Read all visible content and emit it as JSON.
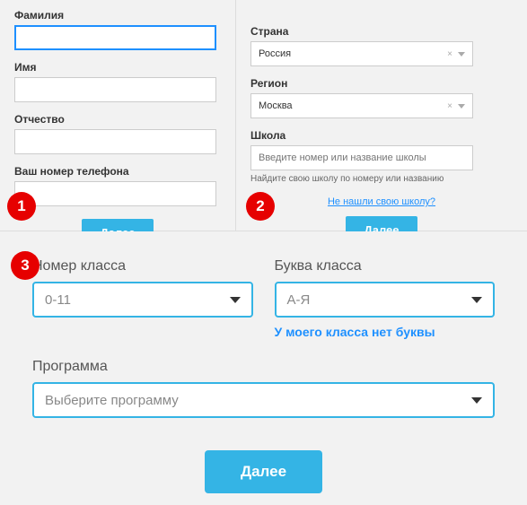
{
  "panel1": {
    "last_name_label": "Фамилия",
    "first_name_label": "Имя",
    "patronymic_label": "Отчество",
    "phone_label": "Ваш номер телефона",
    "next": "Далее"
  },
  "panel2": {
    "country_label": "Страна",
    "country_value": "Россия",
    "region_label": "Регион",
    "region_value": "Москва",
    "school_label": "Школа",
    "school_placeholder": "Введите номер или название школы",
    "school_hint": "Найдите свою школу по номеру или названию",
    "not_found_link": "Не нашли свою школу?",
    "next": "Далее"
  },
  "panel3": {
    "class_num_label": "Номер класса",
    "class_num_value": "0-11",
    "class_letter_label": "Буква класса",
    "class_letter_value": "А-Я",
    "no_letter_link": "У моего класса нет буквы",
    "program_label": "Программа",
    "program_placeholder": "Выберите программу",
    "next": "Далее"
  },
  "badges": {
    "b1": "1",
    "b2": "2",
    "b3": "3"
  }
}
